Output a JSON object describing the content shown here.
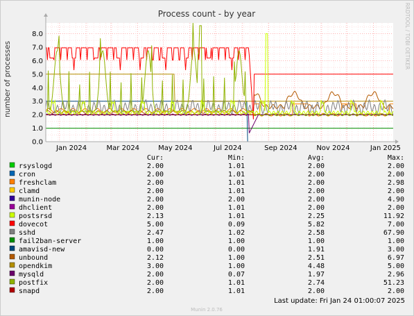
{
  "side_label": "RRDTOOL / TOBI OETIKER",
  "footer": {
    "last_update": "Last update: Fri Jan 24 01:00:07 2025",
    "munin": "Munin 2.0.76"
  },
  "colors": {
    "background": "#f0f0f0",
    "plot_bg": "#ffffff",
    "grid": "#ff9999",
    "axis": "#aaaaaa"
  },
  "chart_data": {
    "type": "line",
    "title": "Process count - by year",
    "ylabel": "number of processes",
    "ylim": [
      0,
      8.8
    ],
    "y_ticks": [
      "0.0",
      "1.0",
      "2.0",
      "3.0",
      "4.0",
      "5.0",
      "6.0",
      "7.0",
      "8.0"
    ],
    "x_ticks": [
      "Jan 2024",
      "Mar 2024",
      "May 2024",
      "Jul 2024",
      "Sep 2024",
      "Nov 2024",
      "Jan 2025"
    ],
    "x_range": [
      "2023-12-16",
      "2025-01-24"
    ],
    "legend_headers": {
      "cur": "Cur:",
      "min": "Min:",
      "avg": "Avg:",
      "max": "Max:"
    },
    "series": [
      {
        "name": "rsyslogd",
        "color": "#00cc00",
        "cur": "2.00",
        "min": "1.01",
        "avg": "2.00",
        "max": "2.00"
      },
      {
        "name": "cron",
        "color": "#0066b3",
        "cur": "2.00",
        "min": "1.01",
        "avg": "2.00",
        "max": "2.00"
      },
      {
        "name": "freshclam",
        "color": "#ff8000",
        "cur": "2.00",
        "min": "1.01",
        "avg": "2.00",
        "max": "2.98"
      },
      {
        "name": "clamd",
        "color": "#ffcc00",
        "cur": "2.00",
        "min": "1.01",
        "avg": "2.00",
        "max": "2.00"
      },
      {
        "name": "munin-node",
        "color": "#330099",
        "cur": "2.00",
        "min": "2.00",
        "avg": "2.00",
        "max": "4.90"
      },
      {
        "name": "dhclient",
        "color": "#990099",
        "cur": "2.00",
        "min": "1.01",
        "avg": "2.00",
        "max": "2.00"
      },
      {
        "name": "postsrsd",
        "color": "#ccff00",
        "cur": "2.13",
        "min": "1.01",
        "avg": "2.25",
        "max": "11.92"
      },
      {
        "name": "dovecot",
        "color": "#ff0000",
        "cur": "5.00",
        "min": "0.09",
        "avg": "5.82",
        "max": "7.00"
      },
      {
        "name": "sshd",
        "color": "#808080",
        "cur": "2.47",
        "min": "1.02",
        "avg": "2.58",
        "max": "67.90"
      },
      {
        "name": "fail2ban-server",
        "color": "#008f00",
        "cur": "1.00",
        "min": "1.00",
        "avg": "1.00",
        "max": "1.00"
      },
      {
        "name": "amavisd-new",
        "color": "#00487d",
        "cur": "0.00",
        "min": "0.00",
        "avg": "1.91",
        "max": "3.00"
      },
      {
        "name": "unbound",
        "color": "#b35a00",
        "cur": "2.12",
        "min": "1.00",
        "avg": "2.51",
        "max": "6.97"
      },
      {
        "name": "opendkim",
        "color": "#b38f00",
        "cur": "3.00",
        "min": "1.00",
        "avg": "4.48",
        "max": "5.00"
      },
      {
        "name": "mysqld",
        "color": "#6b006b",
        "cur": "2.00",
        "min": "0.07",
        "avg": "1.97",
        "max": "2.96"
      },
      {
        "name": "postfix",
        "color": "#8fb300",
        "cur": "2.00",
        "min": "1.01",
        "avg": "2.74",
        "max": "51.23"
      },
      {
        "name": "snapd",
        "color": "#b30000",
        "cur": "2.00",
        "min": "1.01",
        "avg": "2.00",
        "max": "2.00"
      }
    ]
  }
}
